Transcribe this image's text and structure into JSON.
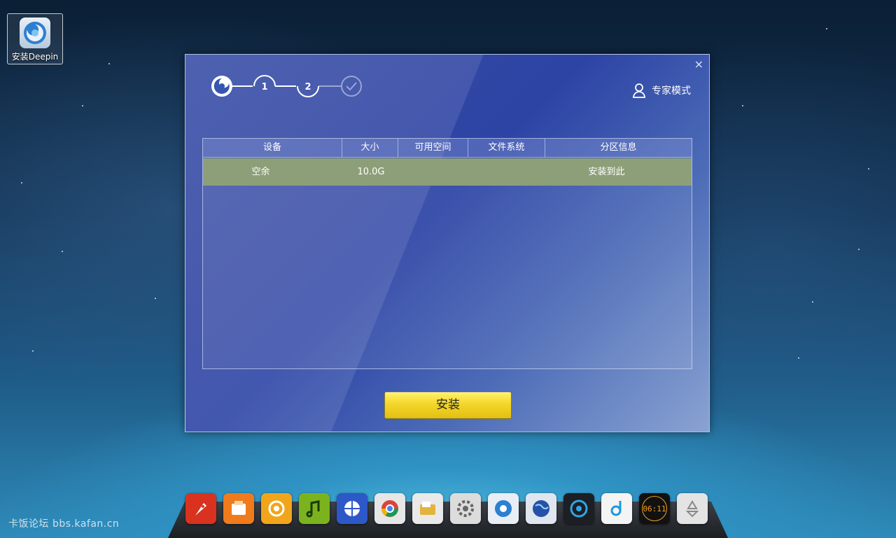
{
  "desktop": {
    "icons": [
      {
        "label": "安装Deepin",
        "icon": "deepin-installer-icon"
      }
    ],
    "watermark": "卡饭论坛 bbs.kafan.cn"
  },
  "installer": {
    "close_glyph": "×",
    "steps": [
      {
        "label": "",
        "icon": "deepin-logo-icon",
        "state": "done"
      },
      {
        "label": "1",
        "state": "done"
      },
      {
        "label": "2",
        "state": "current"
      },
      {
        "label": "",
        "icon": "check-icon",
        "state": "pending"
      }
    ],
    "expert_mode_label": "专家模式",
    "table": {
      "columns": [
        "设备",
        "大小",
        "可用空间",
        "文件系统",
        "分区信息"
      ],
      "rows": [
        {
          "device": "空余",
          "size": "10.0G",
          "free": "",
          "filesystem": "",
          "info": "安装到此"
        }
      ]
    },
    "install_button": "安装"
  },
  "dock": {
    "items": [
      {
        "name": "launcher",
        "icon": "rocket-icon",
        "color": "#d9321f"
      },
      {
        "name": "package-installer",
        "icon": "package-icon",
        "color": "#f07b1c"
      },
      {
        "name": "deepin-store",
        "icon": "swirl-icon",
        "color": "#f1a51b"
      },
      {
        "name": "music-player",
        "icon": "music-note-icon",
        "color": "#7bb31e"
      },
      {
        "name": "browser-3d",
        "icon": "globe-icon",
        "color": "#2d58c8"
      },
      {
        "name": "chrome",
        "icon": "chrome-icon",
        "color": "#e6e6e6"
      },
      {
        "name": "file-manager",
        "icon": "folder-icon",
        "color": "#e9e9e9"
      },
      {
        "name": "system-settings",
        "icon": "gear-icon",
        "color": "#dcdcdc"
      },
      {
        "name": "deepin-installer",
        "icon": "deepin-logo-icon",
        "color": "#e8eef5"
      },
      {
        "name": "earth-browser",
        "icon": "earth-icon",
        "color": "#e0e6ef"
      },
      {
        "name": "media-player",
        "icon": "media-icon",
        "color": "#1c1f24"
      },
      {
        "name": "deepin-music",
        "icon": "d-music-icon",
        "color": "#f4f4f4"
      },
      {
        "name": "clock",
        "icon": "clock-icon",
        "color": "#111111",
        "clock_text": "06:11"
      },
      {
        "name": "trash",
        "icon": "recycle-icon",
        "color": "#e4e4e4"
      }
    ]
  }
}
